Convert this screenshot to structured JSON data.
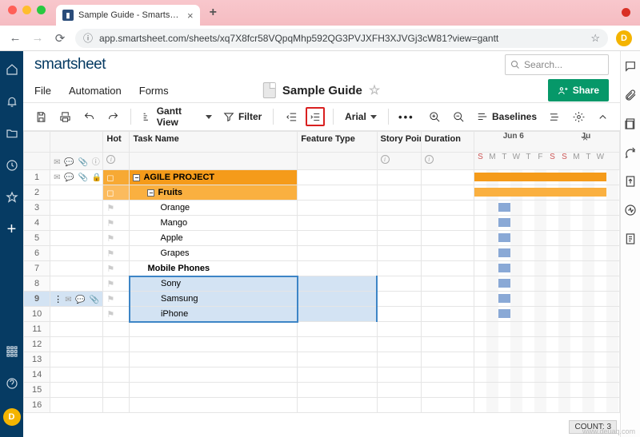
{
  "browser": {
    "tab_title": "Sample Guide - Smartsheet.co",
    "url": "app.smartsheet.com/sheets/xq7X8fcr58VQpqMhp592QG3PVJXFH3XJVGj3cW81?view=gantt",
    "avatar_initial": "D"
  },
  "app": {
    "logo": "smartsheet",
    "search_placeholder": "Search...",
    "menu": {
      "file": "File",
      "automation": "Automation",
      "forms": "Forms"
    },
    "sheet_title": "Sample Guide",
    "share": "Share",
    "rail_user": "D"
  },
  "toolbar": {
    "view_label": "Gantt View",
    "filter": "Filter",
    "font": "Arial",
    "baselines": "Baselines"
  },
  "columns": {
    "hot": "Hot",
    "task": "Task Name",
    "feature": "Feature Type",
    "story": "Story Points",
    "duration": "Duration",
    "month1": "Jun 6",
    "month2": "Ju"
  },
  "rows": [
    {
      "n": "1",
      "name": "AGILE PROJECT",
      "lvl": 1,
      "group": true,
      "icons": true
    },
    {
      "n": "2",
      "name": "Fruits",
      "lvl": 2,
      "group": true
    },
    {
      "n": "3",
      "name": "Orange",
      "lvl": 3
    },
    {
      "n": "4",
      "name": "Mango",
      "lvl": 3
    },
    {
      "n": "5",
      "name": "Apple",
      "lvl": 3
    },
    {
      "n": "6",
      "name": "Grapes",
      "lvl": 3
    },
    {
      "n": "7",
      "name": "Mobile Phones",
      "lvl": 2,
      "bold": true
    },
    {
      "n": "8",
      "name": "Sony",
      "lvl": 3,
      "sel": true
    },
    {
      "n": "9",
      "name": "Samsung",
      "lvl": 3,
      "sel": true,
      "active": true,
      "icons": true
    },
    {
      "n": "10",
      "name": "iPhone",
      "lvl": 3,
      "sel": true
    },
    {
      "n": "11",
      "name": ""
    },
    {
      "n": "12",
      "name": ""
    },
    {
      "n": "13",
      "name": ""
    },
    {
      "n": "14",
      "name": ""
    },
    {
      "n": "15",
      "name": ""
    },
    {
      "n": "16",
      "name": ""
    }
  ],
  "days": [
    "S",
    "M",
    "T",
    "W",
    "T",
    "F",
    "S",
    "S",
    "M",
    "T",
    "W"
  ],
  "count_label": "COUNT:  3"
}
